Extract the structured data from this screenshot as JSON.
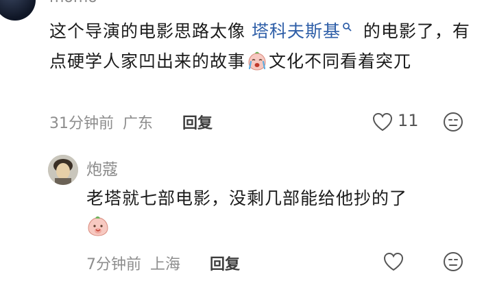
{
  "comments": [
    {
      "username": "momo",
      "text_before_link": "这个导演的电影思路太像 ",
      "link_text": "塔科夫斯基",
      "text_after_link": " 的电影了，有点硬学人家凹出来的故事",
      "text_after_emoji": "文化不同看着突兀",
      "time": "31分钟前",
      "location": "广东",
      "reply_label": "回复",
      "like_count": "11"
    },
    {
      "username": "炮蔻",
      "text": "老塔就七部电影，没剩几部能给他抄的了",
      "time": "7分钟前",
      "location": "上海",
      "reply_label": "回复"
    }
  ],
  "icons": {
    "search": "search-icon",
    "like": "heart-outline-icon",
    "dislike": "unhappy-face-icon",
    "emoji_crying": "crying-emoji",
    "emoji_peach": "peach-emoji"
  },
  "colors": {
    "link": "#2f5fa8",
    "meta": "#8d8d8d",
    "text": "#1b1b1b"
  }
}
